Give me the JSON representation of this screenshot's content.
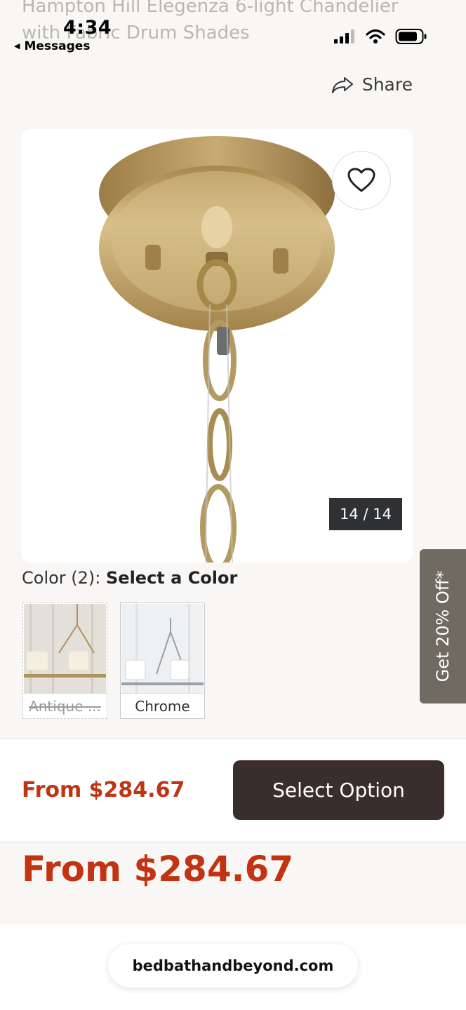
{
  "product": {
    "title": "Hampton Hill Elegenza 6-light Chandelier with Fabric Drum Shades"
  },
  "status": {
    "time": "4:34",
    "back_app": "Messages"
  },
  "actions": {
    "share": "Share"
  },
  "gallery": {
    "counter": "14 / 14"
  },
  "color": {
    "label": "Color (2):",
    "prompt": "Select a Color",
    "options": [
      {
        "label": "Antique ...",
        "available": false
      },
      {
        "label": "Chrome",
        "available": true
      }
    ]
  },
  "promo": {
    "tab": "Get 20% Off*"
  },
  "purchase": {
    "price": "From $284.67",
    "button": "Select Option",
    "price_large": "From $284.67"
  },
  "browser": {
    "url": "bedbathandbeyond.com"
  },
  "colors": {
    "price": "#c23312",
    "button": "#3a2e2c",
    "promo": "#6f6a62",
    "brass": "#b89b5e"
  }
}
